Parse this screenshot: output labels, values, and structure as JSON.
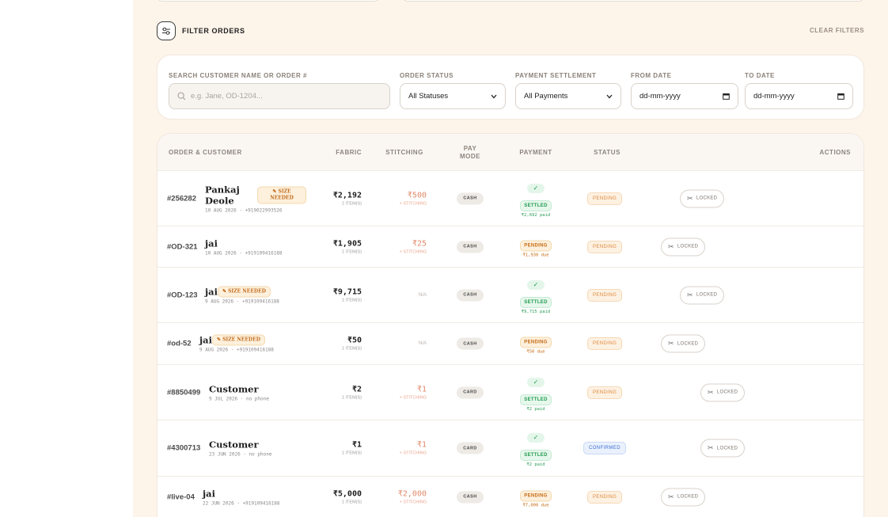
{
  "filters": {
    "title": "FILTER ORDERS",
    "clear_label": "CLEAR FILTERS",
    "search": {
      "label": "SEARCH CUSTOMER NAME OR ORDER #",
      "placeholder": "e.g. Jane, OD-1204..."
    },
    "order_status": {
      "label": "ORDER STATUS",
      "value": "All Statuses"
    },
    "payment_settlement": {
      "label": "PAYMENT SETTLEMENT",
      "value": "All Payments"
    },
    "from_date": {
      "label": "FROM DATE",
      "value": "dd-mm-yyyy"
    },
    "to_date": {
      "label": "TO DATE",
      "value": "dd-mm-yyyy"
    }
  },
  "table": {
    "headers": {
      "order_customer": "ORDER & CUSTOMER",
      "fabric": "FABRIC",
      "stitching": "STITCHING",
      "pay_mode": "PAY MODE",
      "payment": "PAYMENT",
      "status": "STATUS",
      "actions": "ACTIONS"
    },
    "rows": [
      {
        "id": "#256282",
        "name": "Pankaj Deole",
        "meta": "10 AUG 2026 · +919022993526",
        "size_badge": "✎ SIZE NEEDED",
        "fabric": "₹2,192",
        "fabric_sub": "2 ITEM(S)",
        "stitching": "₹500",
        "stitching_sub": "+ STITCHING",
        "pay_mode": "CASH",
        "payment_badge": "SETTLED",
        "payment_kind": "settled",
        "payment_check": "✓",
        "payment_amt": "₹2,692 paid",
        "status": "PENDING",
        "status_kind": "pending",
        "action": "LOCKED"
      },
      {
        "id": "#OD-321",
        "name": "jai",
        "meta": "10 AUG 2026 · +919109416188",
        "size_badge": "",
        "fabric": "₹1,905",
        "fabric_sub": "1 ITEM(S)",
        "stitching": "₹25",
        "stitching_sub": "+ STITCHING",
        "pay_mode": "CASH",
        "payment_badge": "PENDING",
        "payment_kind": "pending",
        "payment_check": "",
        "payment_amt": "₹1,930 due",
        "status": "PENDING",
        "status_kind": "pending",
        "action": "LOCKED"
      },
      {
        "id": "#OD-123",
        "name": "jai",
        "meta": "9 AUG 2026 · +919109416188",
        "size_badge": "✎ SIZE NEEDED",
        "fabric": "₹9,715",
        "fabric_sub": "1 ITEM(S)",
        "stitching": "N/A",
        "stitching_sub": "",
        "pay_mode": "CASH",
        "payment_badge": "SETTLED",
        "payment_kind": "settled",
        "payment_check": "✓",
        "payment_amt": "₹9,715 paid",
        "status": "PENDING",
        "status_kind": "pending",
        "action": "LOCKED"
      },
      {
        "id": "#od-52",
        "name": "jai",
        "meta": "9 AUG 2026 · +919109416188",
        "size_badge": "✎ SIZE NEEDED",
        "fabric": "₹50",
        "fabric_sub": "1 ITEM(S)",
        "stitching": "N/A",
        "stitching_sub": "",
        "pay_mode": "CASH",
        "payment_badge": "PENDING",
        "payment_kind": "pending",
        "payment_check": "",
        "payment_amt": "₹50 due",
        "status": "PENDING",
        "status_kind": "pending",
        "action": "LOCKED"
      },
      {
        "id": "#8850499",
        "name": "Customer",
        "meta": "9 JUL 2026 · no phone",
        "size_badge": "",
        "fabric": "₹2",
        "fabric_sub": "1 ITEM(S)",
        "stitching": "₹1",
        "stitching_sub": "+ STITCHING",
        "pay_mode": "CARD",
        "payment_badge": "SETTLED",
        "payment_kind": "settled",
        "payment_check": "✓",
        "payment_amt": "₹2 paid",
        "status": "PENDING",
        "status_kind": "pending",
        "action": "LOCKED"
      },
      {
        "id": "#4300713",
        "name": "Customer",
        "meta": "23 JUN 2026 · no phone",
        "size_badge": "",
        "fabric": "₹1",
        "fabric_sub": "1 ITEM(S)",
        "stitching": "₹1",
        "stitching_sub": "+ STITCHING",
        "pay_mode": "CARD",
        "payment_badge": "SETTLED",
        "payment_kind": "settled",
        "payment_check": "✓",
        "payment_amt": "₹2 paid",
        "status": "CONFIRMED",
        "status_kind": "confirmed",
        "action": "LOCKED"
      },
      {
        "id": "#live-04",
        "name": "jai",
        "meta": "22 JUN 2026 · +919109416188",
        "size_badge": "",
        "fabric": "₹5,000",
        "fabric_sub": "1 ITEM(S)",
        "stitching": "₹2,000",
        "stitching_sub": "+ STITCHING",
        "pay_mode": "CASH",
        "payment_badge": "PENDING",
        "payment_kind": "pending",
        "payment_check": "",
        "payment_amt": "₹7,000 due",
        "status": "PENDING",
        "status_kind": "pending",
        "action": "LOCKED"
      }
    ]
  }
}
